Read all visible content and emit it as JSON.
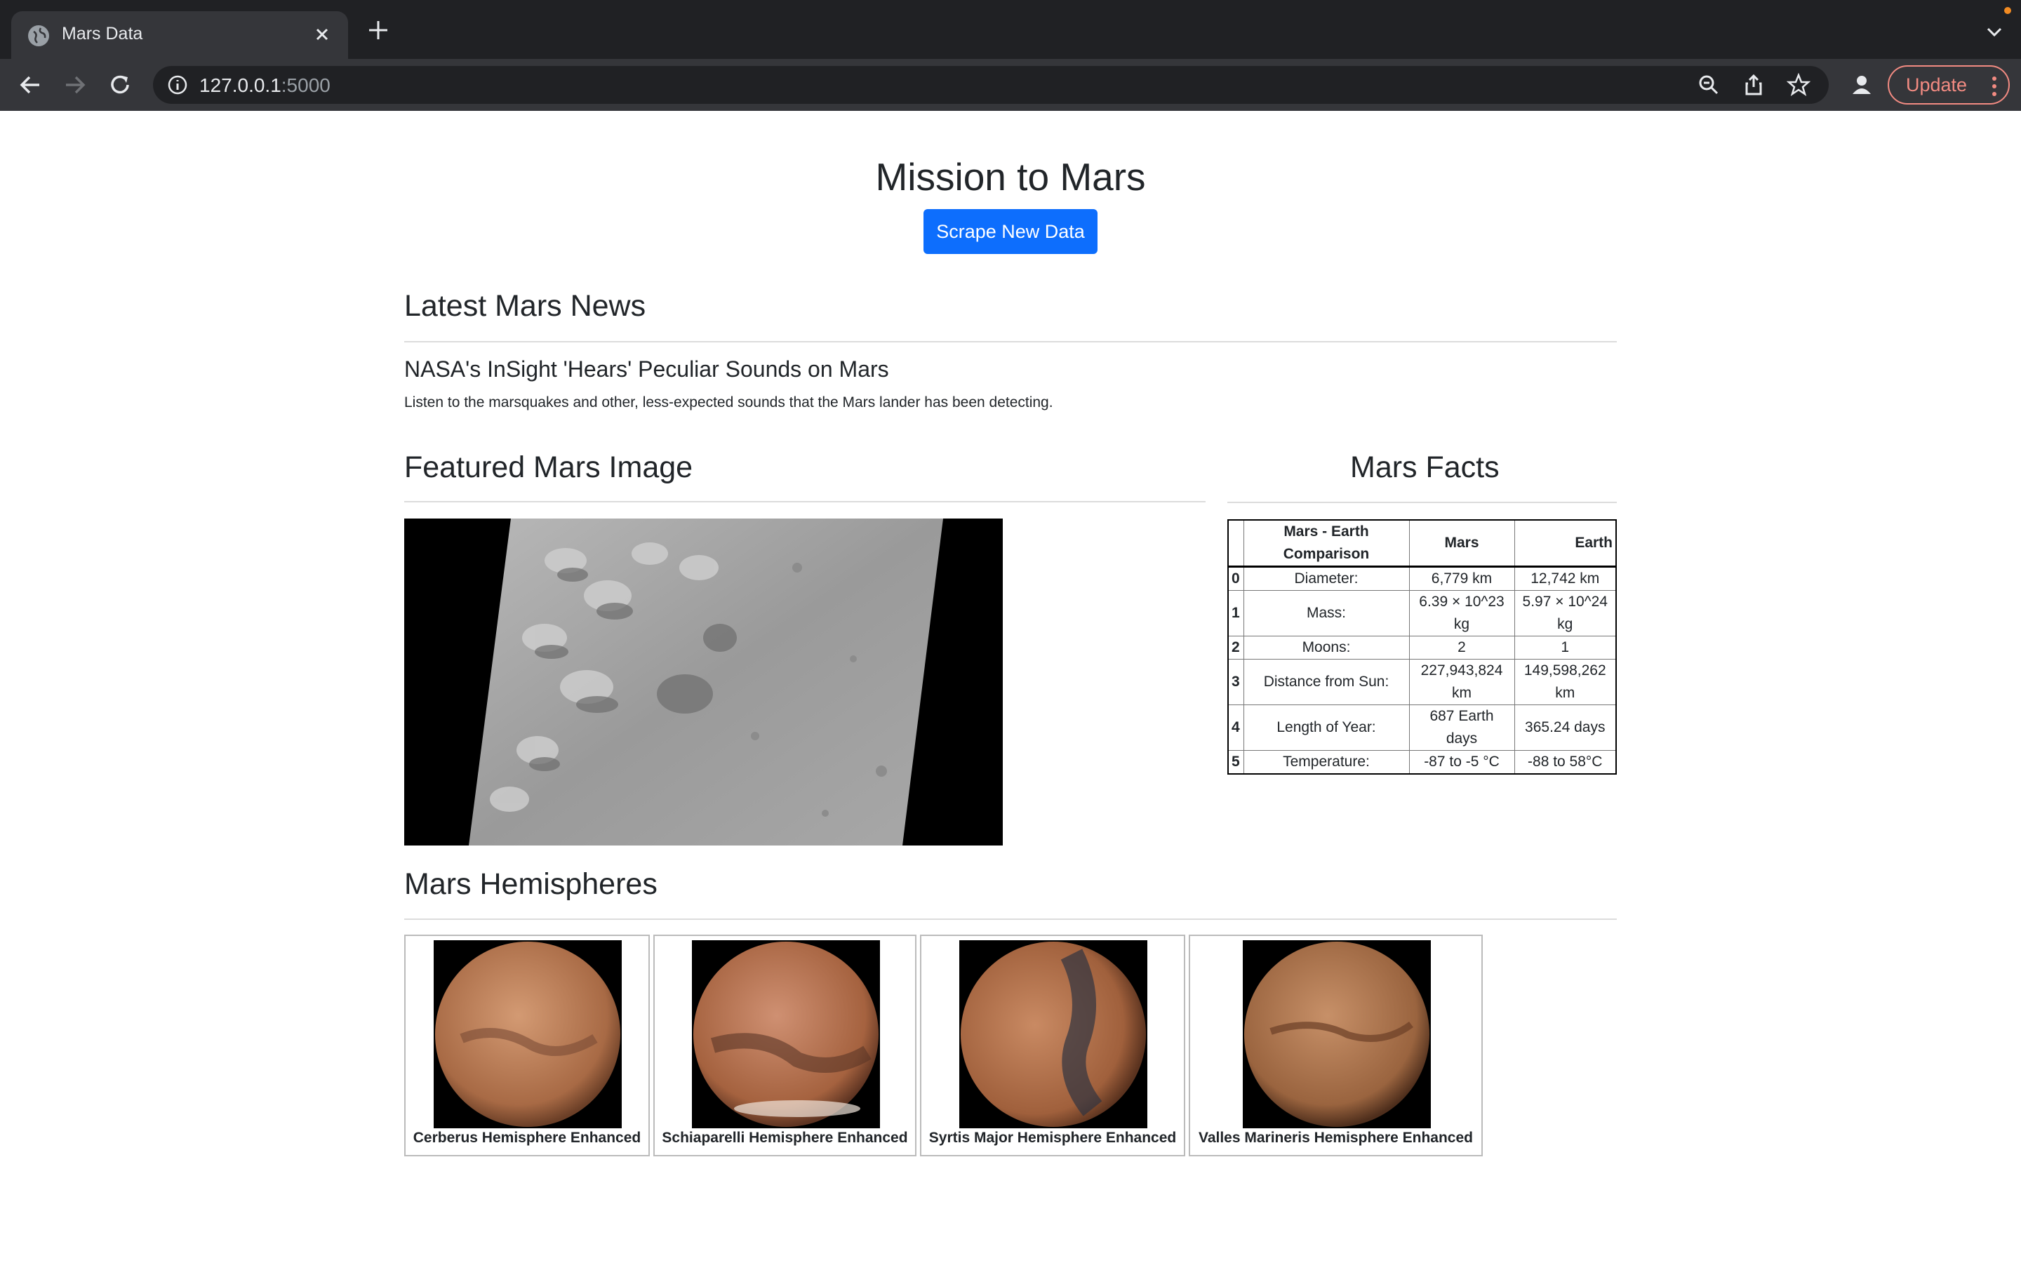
{
  "browser": {
    "tab_title": "Mars Data",
    "url_host": "127.0.0.1",
    "url_port": ":5000",
    "update_label": "Update"
  },
  "page": {
    "title": "Mission to Mars",
    "scrape_button": "Scrape New Data",
    "news": {
      "heading": "Latest Mars News",
      "title": "NASA's InSight 'Hears' Peculiar Sounds on Mars",
      "paragraph": "Listen to the marsquakes and other, less-expected sounds that the Mars lander has been detecting."
    },
    "featured": {
      "heading": "Featured Mars Image"
    },
    "facts": {
      "heading": "Mars Facts",
      "columns": [
        "",
        "Mars - Earth Comparison",
        "Mars",
        "Earth"
      ],
      "rows": [
        {
          "idx": "0",
          "label": "Diameter:",
          "mars": "6,779 km",
          "earth": "12,742 km"
        },
        {
          "idx": "1",
          "label": "Mass:",
          "mars": "6.39 × 10^23 kg",
          "earth": "5.97 × 10^24 kg"
        },
        {
          "idx": "2",
          "label": "Moons:",
          "mars": "2",
          "earth": "1"
        },
        {
          "idx": "3",
          "label": "Distance from Sun:",
          "mars": "227,943,824 km",
          "earth": "149,598,262 km"
        },
        {
          "idx": "4",
          "label": "Length of Year:",
          "mars": "687 Earth days",
          "earth": "365.24 days"
        },
        {
          "idx": "5",
          "label": "Temperature:",
          "mars": "-87 to -5 °C",
          "earth": "-88 to 58°C"
        }
      ]
    },
    "hemispheres": {
      "heading": "Mars Hemispheres",
      "items": [
        {
          "title": "Cerberus Hemisphere Enhanced"
        },
        {
          "title": "Schiaparelli Hemisphere Enhanced"
        },
        {
          "title": "Syrtis Major Hemisphere Enhanced"
        },
        {
          "title": "Valles Marineris Hemisphere Enhanced"
        }
      ]
    }
  }
}
